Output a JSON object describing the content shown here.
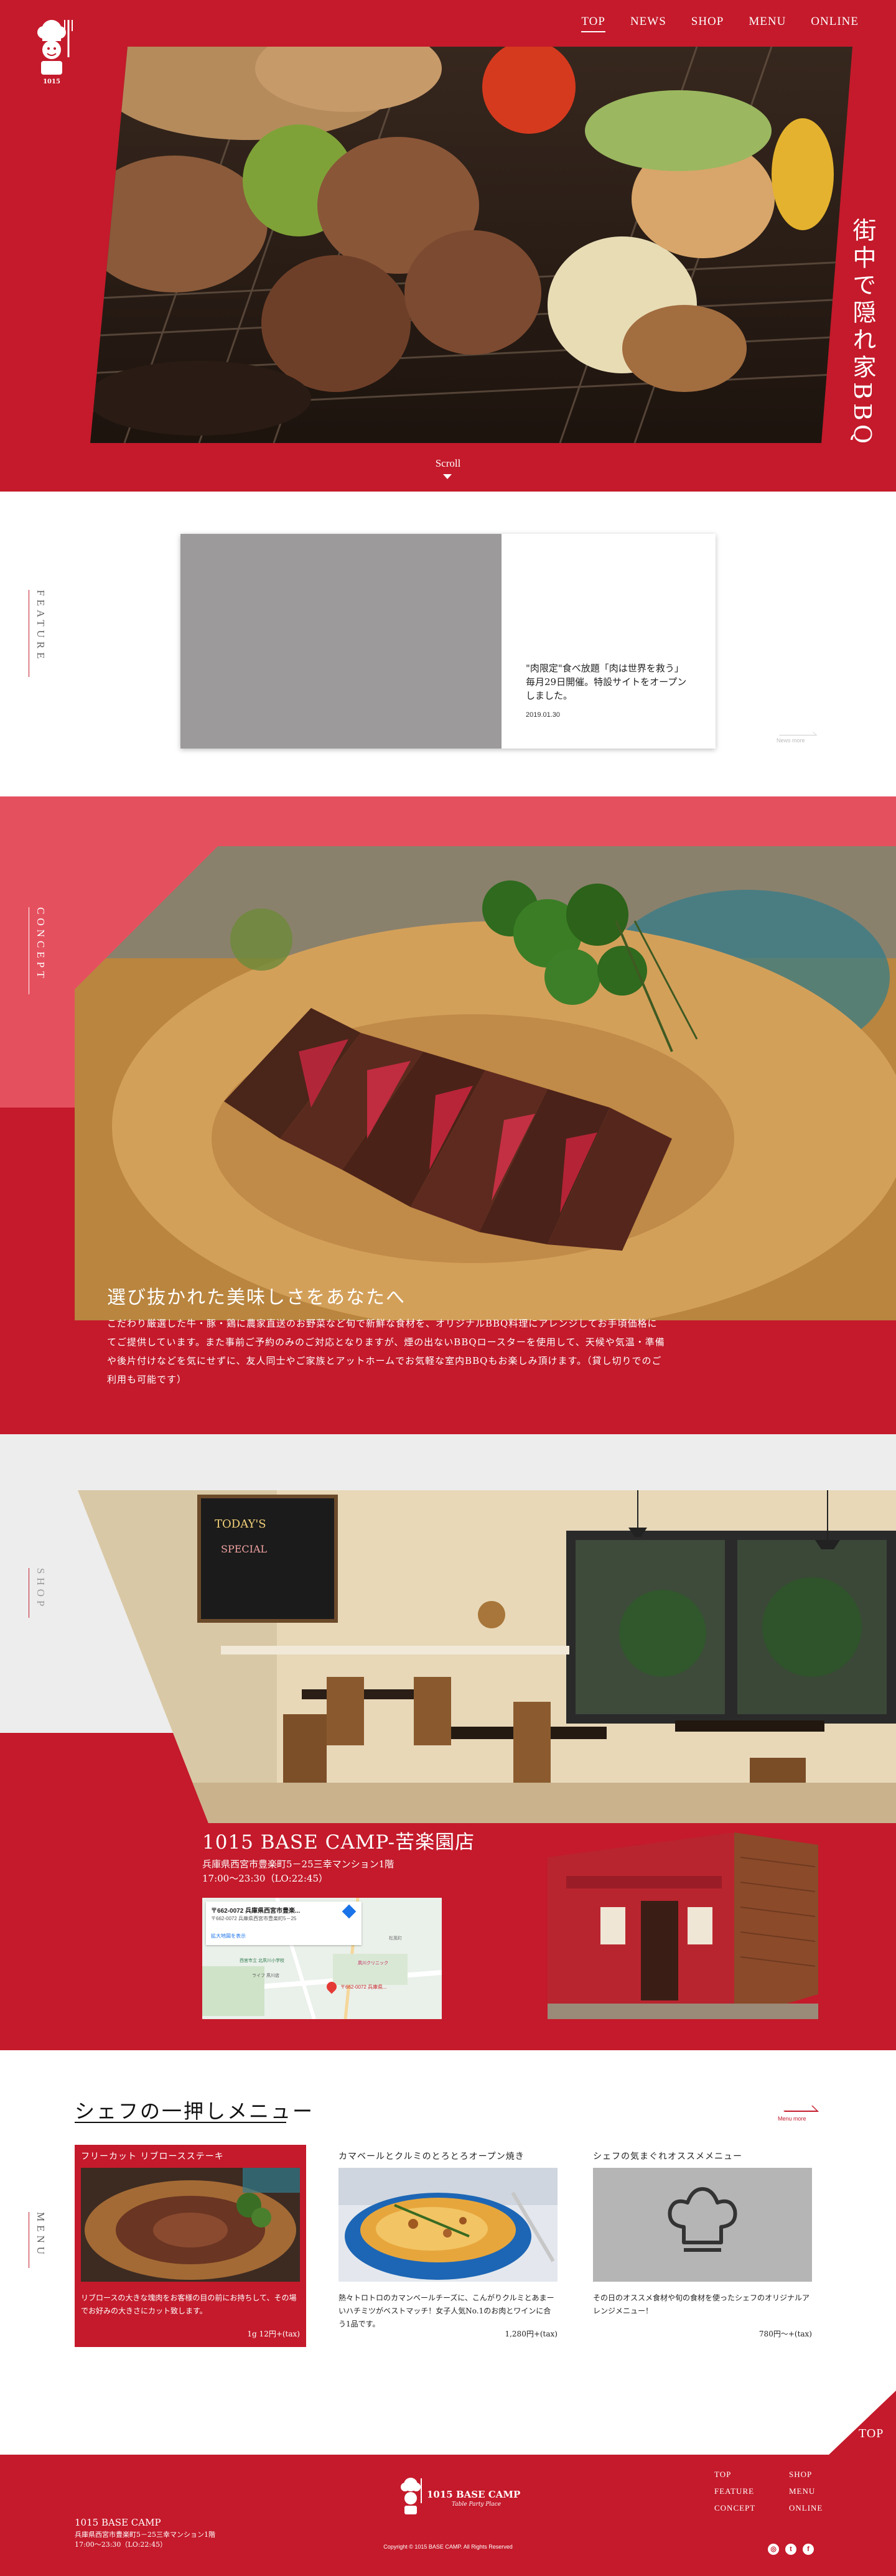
{
  "nav": {
    "items": [
      {
        "label": "TOP",
        "active": true
      },
      {
        "label": "NEWS",
        "active": false
      },
      {
        "label": "SHOP",
        "active": false
      },
      {
        "label": "MENU",
        "active": false
      },
      {
        "label": "ONLINE",
        "active": false
      }
    ]
  },
  "hero": {
    "tagline": "街中で隠れ家BBQ",
    "scroll_label": "Scroll"
  },
  "feature": {
    "side_label": "FEATURE",
    "article_text": "\"肉限定\"食べ放題「肉は世界を救う」毎月29日開催。特設サイトをオープンしました。",
    "article_date": "2019.01.30",
    "more_label": "News more"
  },
  "concept": {
    "side_label": "CONCEPT",
    "heading": "選び抜かれた美味しさをあなたへ",
    "body": "こだわり厳選した牛・豚・鶏に農家直送のお野菜など旬で新鮮な食材を、オリジナルBBQ料理にアレンジしてお手頃価格にてご提供しています。また事前ご予約のみのご対応となりますが、煙の出ないBBQロースターを使用して、天候や気温・準備や後片付けなどを気にせずに、友人同士やご家族とアットホームでお気軽な室内BBQもお楽しみ頂けます。（貸し切りでのご利用も可能です）"
  },
  "shop": {
    "side_label": "SHOP",
    "name": "1015 BASE CAMP-苦楽園店",
    "address": "兵庫県西宮市豊楽町5－25三幸マンション1階",
    "hours": "17:00～23:30（LO:22:45）",
    "map": {
      "card_title": "〒662-0072 兵庫県西宮市豊楽...",
      "card_address": "〒662-0072 兵庫県西宮市豊楽町5－25",
      "card_link": "拡大地図を表示",
      "pin_label": "〒662-0072 兵庫県...",
      "place_labels": [
        "西宮市立 北夙川小学校",
        "夙川クリニック",
        "ライフ 夙川店",
        "松風町"
      ]
    }
  },
  "menu": {
    "side_label": "MENU",
    "title": "シェフの一押しメニュー",
    "more_label": "Menu more",
    "cards": [
      {
        "title": "フリーカット リブロースステーキ",
        "description": "リブロースの大きな塊肉をお客様の目の前にお持ちして、その場でお好みの大きさにカット致します。",
        "price": "1g 12円+(tax)"
      },
      {
        "title": "カマベールとクルミのとろとろオープン焼き",
        "description": "熱々トロトロのカマンベールチーズに、こんがりクルミとあまーいハチミツがベストマッチ！女子人気No.1のお肉とワインに合う1品です。",
        "price": "1,280円+(tax)"
      },
      {
        "title": "シェフの気まぐれオススメメニュー",
        "description": "その日のオススメ食材や旬の食材を使ったシェフのオリジナルアレンジメニュー！",
        "price": "780円～+(tax)"
      }
    ]
  },
  "top_button": {
    "label": "TOP"
  },
  "footer": {
    "shop_name": "1015 BASE CAMP",
    "address": "兵庫県西宮市豊楽町5－25三幸マンション1階",
    "hours": "17:00～23:30（LO:22:45）",
    "logo_text": "1015 BASE CAMP",
    "logo_sub": "Table Party Place",
    "copyright": "Copyright © 1015 BASE CAMP. All Rights Reserved",
    "nav": [
      "TOP",
      "SHOP",
      "FEATURE",
      "MENU",
      "CONCEPT",
      "ONLINE"
    ],
    "social": [
      {
        "icon": "instagram-icon",
        "glyph": "◎"
      },
      {
        "icon": "twitter-icon",
        "glyph": "t"
      },
      {
        "icon": "facebook-icon",
        "glyph": "f"
      }
    ]
  },
  "colors": {
    "brand_red": "#c41a2b",
    "concept_pink": "#e5505f",
    "shop_grey": "#ededed",
    "feature_placeholder": "#9c9a9a"
  }
}
